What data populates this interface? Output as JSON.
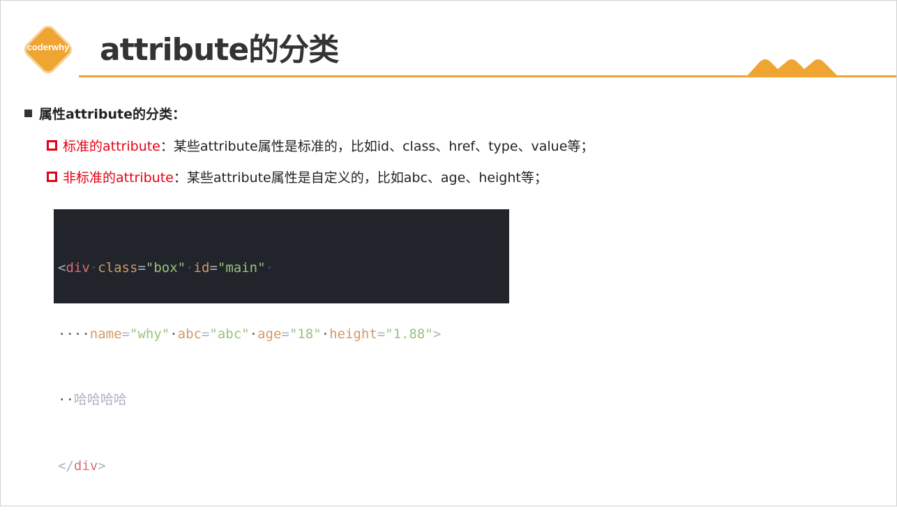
{
  "logo": {
    "text": "coderwhy"
  },
  "title": "attribute的分类",
  "main_bullet": "属性attribute的分类：",
  "items": [
    {
      "label": "标准的attribute",
      "text": "：某些attribute属性是标准的，比如id、class、href、type、value等；"
    },
    {
      "label": "非标准的attribute",
      "text": "：某些attribute属性是自定义的，比如abc、age、height等；"
    }
  ],
  "code": {
    "line1": {
      "open": "<",
      "tag": "div",
      "sp1": "·",
      "attr1": "class",
      "eq1": "=",
      "val1": "\"box\"",
      "sp2": "·",
      "attr2": "id",
      "eq2": "=",
      "val2": "\"main\"",
      "sp3": "·"
    },
    "line2": {
      "indent": "····",
      "attr3": "name",
      "eq3": "=",
      "val3": "\"why\"",
      "sp4": "·",
      "attr4": "abc",
      "eq4": "=",
      "val4": "\"abc\"",
      "sp5": "·",
      "attr5": "age",
      "eq5": "=",
      "val5": "\"18\"",
      "sp6": "·",
      "attr6": "height",
      "eq6": "=",
      "val6": "\"1.88\"",
      "close": ">"
    },
    "line3": {
      "indent": "··",
      "text": "哈哈哈哈"
    },
    "line4": {
      "open": "</",
      "tag": "div",
      "close": ">"
    }
  },
  "colors": {
    "accent": "#f0a431",
    "highlight": "#e60012",
    "code_bg": "#21252b"
  }
}
